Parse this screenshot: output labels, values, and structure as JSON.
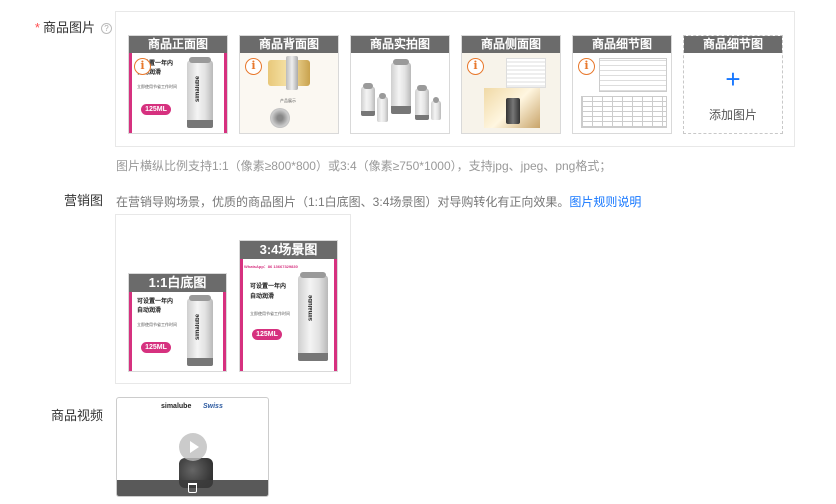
{
  "product_images": {
    "label": "商品图片",
    "required_mark": "*",
    "help_icon": "question-circle-icon",
    "help_glyph": "?",
    "warn_glyph": "i",
    "slots": [
      {
        "caption": "商品正面图"
      },
      {
        "caption": "商品背面图"
      },
      {
        "caption": "商品实拍图"
      },
      {
        "caption": "商品侧面图"
      },
      {
        "caption": "商品细节图"
      },
      {
        "caption": "商品细节图",
        "add_label": "添加图片",
        "add_glyph": "+"
      }
    ],
    "hint": "图片横纵比例支持1:1（像素≥800*800）或3:4（像素≥750*1000），支持jpg、jpeg、png格式；"
  },
  "artwork": {
    "brand": "simalube",
    "line1": "可设置一年内",
    "line2": "自动润滑",
    "subline": "立即使用节省工作时间",
    "volume": "125ML",
    "whatsapp": "WhatsApp：86 13667329830",
    "back_caption": "产品展示",
    "video_logo_left": "simalube",
    "video_logo_right": "Swiss"
  },
  "marketing": {
    "label": "营销图",
    "description": "在营销导购场景，优质的商品图片（1:1白底图、3:4场景图）对导购转化有正向效果。",
    "link": "图片规则说明",
    "items": [
      {
        "caption": "1:1白底图"
      },
      {
        "caption": "3:4场景图"
      }
    ]
  },
  "video": {
    "label": "商品视频",
    "play_icon": "play-icon",
    "delete_icon": "trash-icon"
  },
  "colors": {
    "accent": "#1677ff",
    "required": "#ff4d4f",
    "brand_pink": "#d6317f",
    "caption_bg": "#6b6b6b",
    "warning": "#e8782c"
  }
}
